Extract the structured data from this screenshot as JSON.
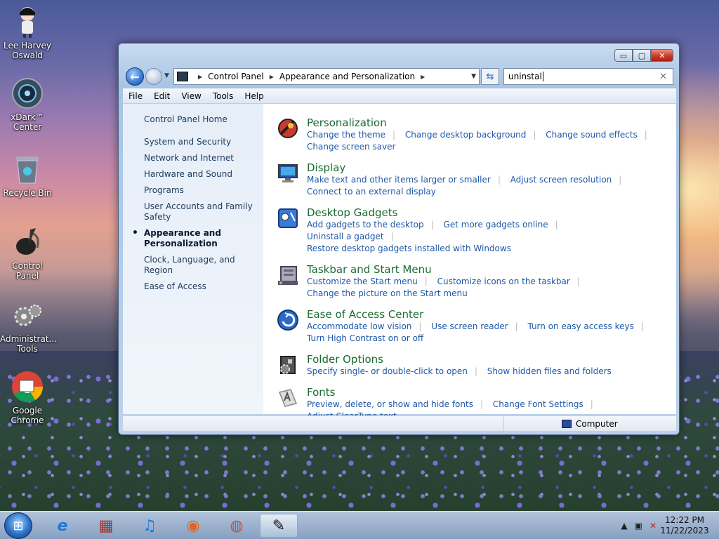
{
  "desktop": {
    "icons": [
      {
        "label": "Lee Harvey Oswald",
        "icon": "user-doll-icon"
      },
      {
        "label": "xDark™ Center",
        "icon": "xdark-disc-icon"
      },
      {
        "label": "Recycle Bin",
        "icon": "recycle-bin-icon"
      },
      {
        "label": "Control Panel",
        "icon": "control-panel-icon"
      },
      {
        "label": "Administrat... Tools",
        "icon": "admin-tools-icon"
      },
      {
        "label": "Google Chrome",
        "icon": "chrome-icon"
      }
    ]
  },
  "window": {
    "caption": {
      "min": "▭",
      "max": "▢",
      "close": "✕"
    },
    "nav": {
      "back": "←",
      "forward": "",
      "drop": "▼"
    },
    "breadcrumb": [
      "Control Panel",
      "Appearance and Personalization"
    ],
    "breadcrumb_sep": "▶",
    "search": {
      "value": "uninstal",
      "clear": "✕"
    },
    "menu": [
      "File",
      "Edit",
      "View",
      "Tools",
      "Help"
    ],
    "left": {
      "home": "Control Panel Home",
      "items": [
        "System and Security",
        "Network and Internet",
        "Hardware and Sound",
        "Programs",
        "User Accounts and Family Safety",
        "Appearance and Personalization",
        "Clock, Language, and Region",
        "Ease of Access"
      ]
    },
    "categories": [
      {
        "title": "Personalization",
        "links": [
          "Change the theme",
          "Change desktop background",
          "Change sound effects",
          "Change screen saver"
        ]
      },
      {
        "title": "Display",
        "links": [
          "Make text and other items larger or smaller",
          "Adjust screen resolution",
          "Connect to an external display"
        ]
      },
      {
        "title": "Desktop Gadgets",
        "links": [
          "Add gadgets to the desktop",
          "Get more gadgets online",
          "Uninstall a gadget",
          "Restore desktop gadgets installed with Windows"
        ]
      },
      {
        "title": "Taskbar and Start Menu",
        "links": [
          "Customize the Start menu",
          "Customize icons on the taskbar",
          "Change the picture on the Start menu"
        ]
      },
      {
        "title": "Ease of Access Center",
        "links": [
          "Accommodate low vision",
          "Use screen reader",
          "Turn on easy access keys",
          "Turn High Contrast on or off"
        ]
      },
      {
        "title": "Folder Options",
        "links": [
          "Specify single- or double-click to open",
          "Show hidden files and folders"
        ]
      },
      {
        "title": "Fonts",
        "links": [
          "Preview, delete, or show and hide fonts",
          "Change Font Settings",
          "Adjust ClearType text"
        ]
      }
    ],
    "status": {
      "location": "Computer"
    }
  },
  "taskbar": {
    "apps": [
      {
        "name": "internet-explorer",
        "glyph": "e"
      },
      {
        "name": "archive-app",
        "glyph": "▦"
      },
      {
        "name": "music-app",
        "glyph": "♫"
      },
      {
        "name": "firefox",
        "glyph": "◉"
      },
      {
        "name": "chrome",
        "glyph": "◍"
      },
      {
        "name": "control-panel",
        "glyph": "✎"
      }
    ],
    "clock": {
      "time": "12:22 PM",
      "date": "11/22/2023"
    },
    "tray": {
      "arrow": "▲",
      "network": "▣",
      "volume": "✕"
    }
  },
  "colors": {
    "category_title": "#1c6a32",
    "link": "#1e58a8",
    "close_button": "#c83a2a"
  }
}
